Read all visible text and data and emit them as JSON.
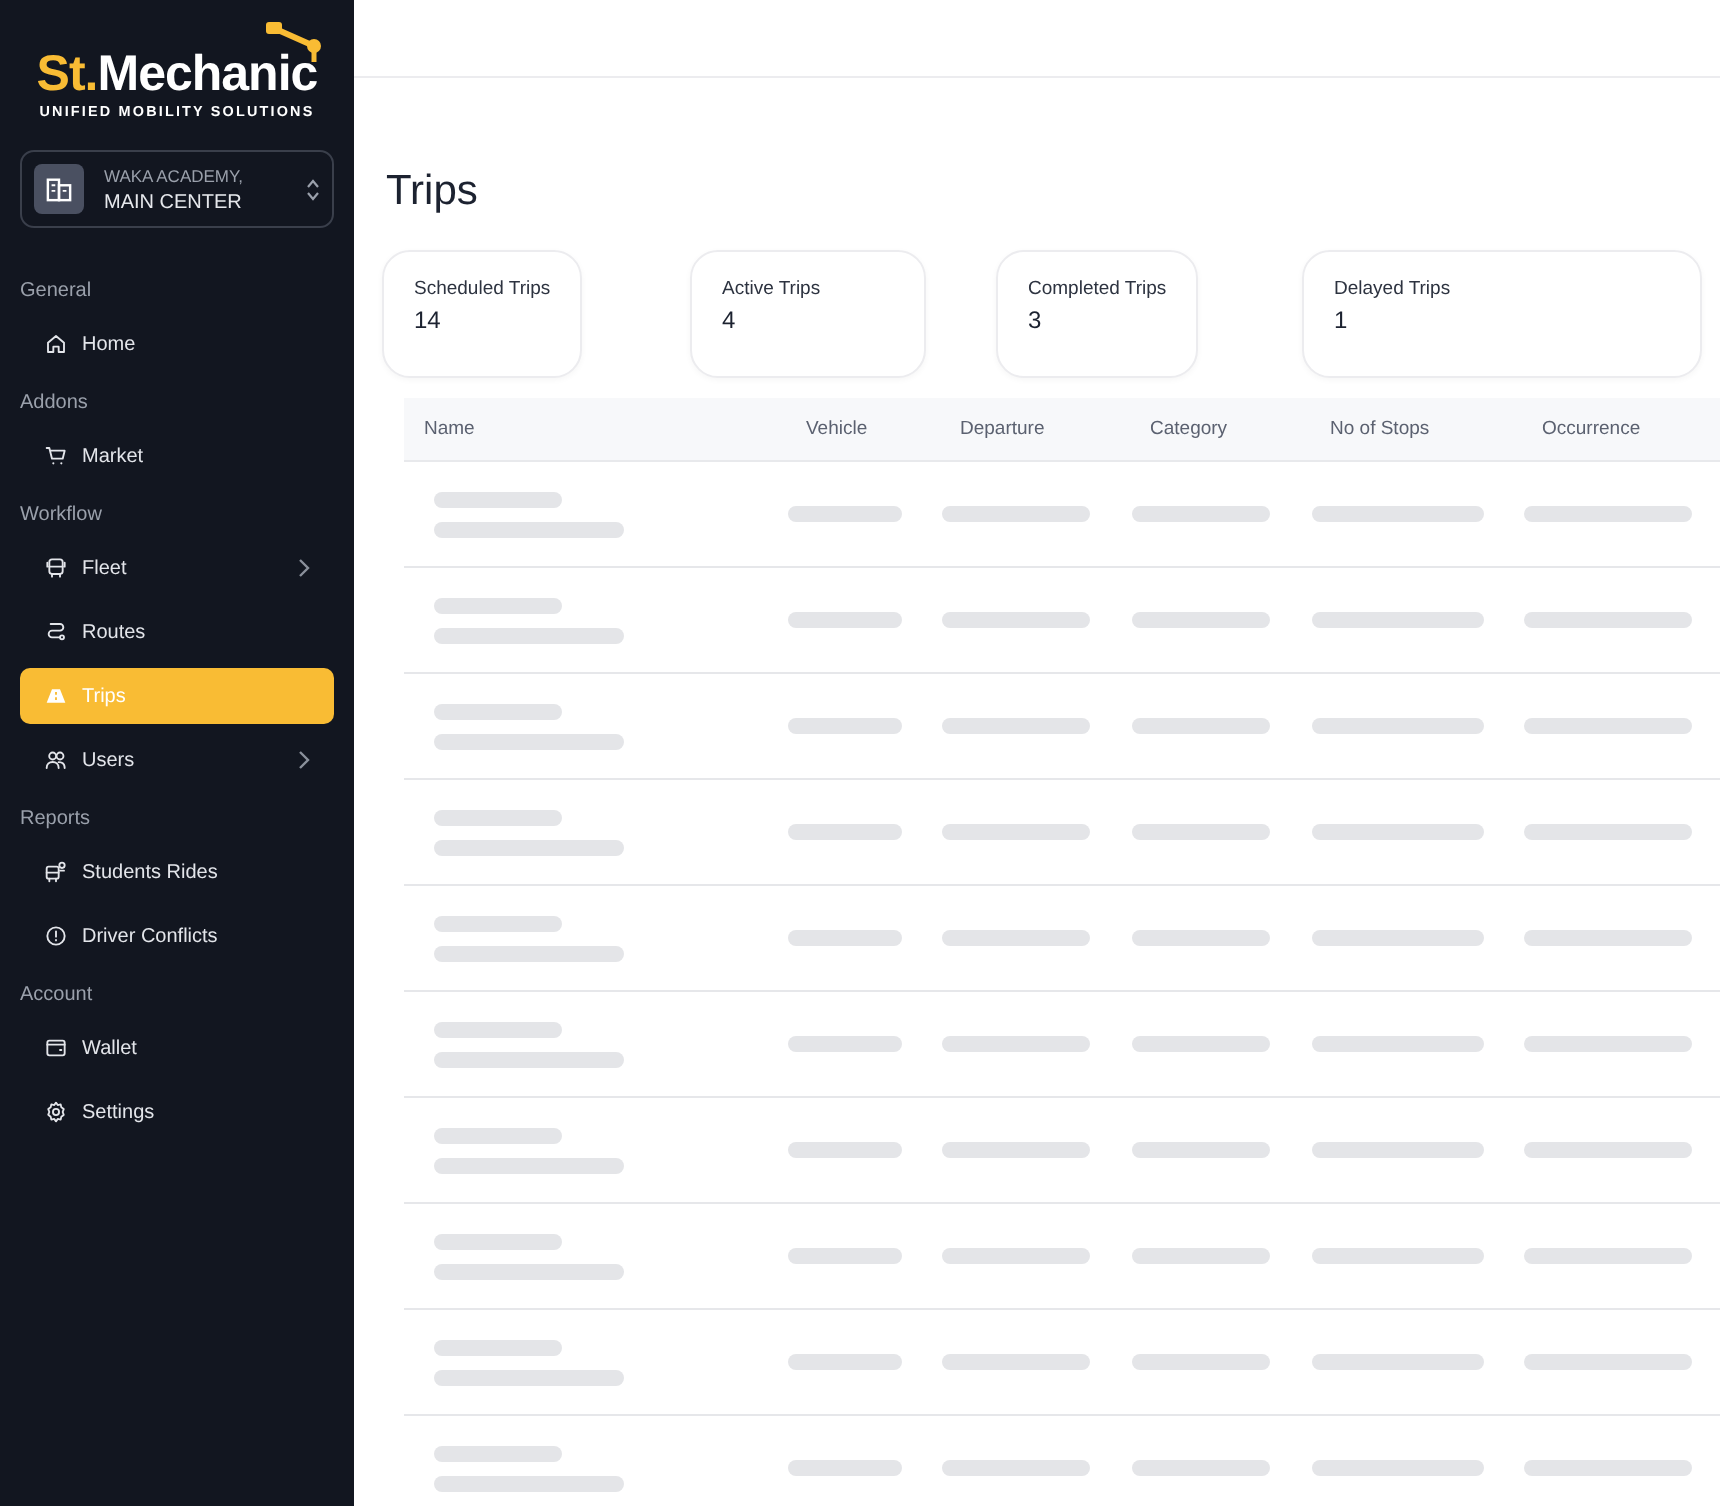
{
  "brand": {
    "prefix": "St.",
    "name": "Mechanic",
    "tagline": "UNIFIED MOBILITY SOLUTIONS"
  },
  "org_selector": {
    "org": "WAKA ACADEMY,",
    "branch": "MAIN CENTER"
  },
  "sidebar": {
    "sections": [
      {
        "title": "General",
        "items": [
          {
            "label": "Home",
            "selected": false,
            "expandable": false
          }
        ]
      },
      {
        "title": "Addons",
        "items": [
          {
            "label": "Market",
            "selected": false,
            "expandable": false
          }
        ]
      },
      {
        "title": "Workflow",
        "items": [
          {
            "label": "Fleet",
            "selected": false,
            "expandable": true
          },
          {
            "label": "Routes",
            "selected": false,
            "expandable": false
          },
          {
            "label": "Trips",
            "selected": true,
            "expandable": false
          },
          {
            "label": "Users",
            "selected": false,
            "expandable": true
          }
        ]
      },
      {
        "title": "Reports",
        "items": [
          {
            "label": "Students Rides",
            "selected": false,
            "expandable": false
          },
          {
            "label": "Driver Conflicts",
            "selected": false,
            "expandable": false
          }
        ]
      },
      {
        "title": "Account",
        "items": [
          {
            "label": "Wallet",
            "selected": false,
            "expandable": false
          },
          {
            "label": "Settings",
            "selected": false,
            "expandable": false
          }
        ]
      }
    ]
  },
  "page": {
    "title": "Trips"
  },
  "stats": [
    {
      "label": "Scheduled Trips",
      "value": "14"
    },
    {
      "label": "Active Trips",
      "value": "4"
    },
    {
      "label": "Completed Trips",
      "value": "3"
    },
    {
      "label": "Delayed Trips",
      "value": "1"
    }
  ],
  "table": {
    "columns": [
      "Name",
      "Vehicle",
      "Departure",
      "Category",
      "No of Stops",
      "Occurrence"
    ],
    "rows": [
      {
        "kind": "skeleton"
      },
      {
        "kind": "skeleton"
      },
      {
        "kind": "skeleton"
      },
      {
        "kind": "skeleton"
      },
      {
        "kind": "skeleton"
      },
      {
        "kind": "skeleton"
      },
      {
        "kind": "skeleton"
      },
      {
        "kind": "skeleton"
      },
      {
        "kind": "skeleton"
      },
      {
        "kind": "skeleton"
      }
    ]
  }
}
